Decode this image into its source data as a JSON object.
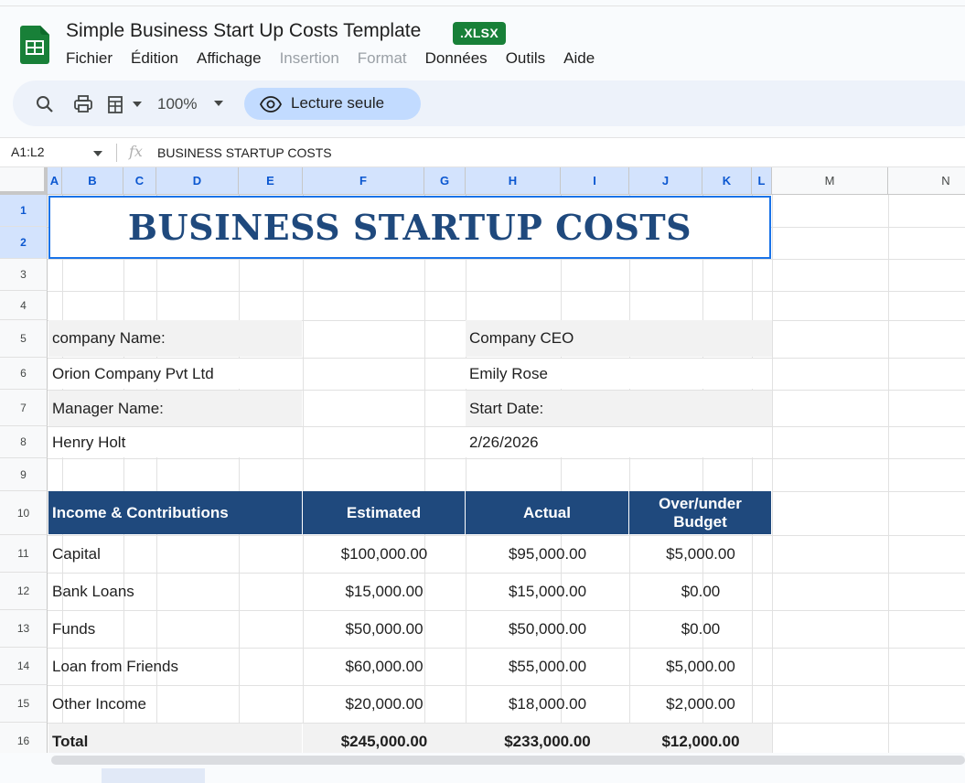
{
  "app": {
    "doc_title": "Simple Business Start Up Costs Template",
    "file_badge": ".XLSX",
    "colors": {
      "brand_green": "#188038",
      "accent_blue": "#1a73e8",
      "header_navy": "#1f497d",
      "readonly_pill": "#c2dbff"
    }
  },
  "menu": [
    {
      "label": "Fichier",
      "enabled": true
    },
    {
      "label": "Édition",
      "enabled": true
    },
    {
      "label": "Affichage",
      "enabled": true
    },
    {
      "label": "Insertion",
      "enabled": false
    },
    {
      "label": "Format",
      "enabled": false
    },
    {
      "label": "Données",
      "enabled": true
    },
    {
      "label": "Outils",
      "enabled": true
    },
    {
      "label": "Aide",
      "enabled": true
    }
  ],
  "toolbar": {
    "icons": [
      "search-icon",
      "print-icon",
      "paint-format-icon"
    ],
    "zoom": "100%",
    "readonly_label": "Lecture seule"
  },
  "formula_bar": {
    "name_box": "A1:L2",
    "fx": "fx",
    "formula": "BUSINESS STARTUP COSTS"
  },
  "columns": [
    "A",
    "B",
    "C",
    "D",
    "E",
    "F",
    "G",
    "H",
    "I",
    "J",
    "K",
    "L",
    "M",
    "N"
  ],
  "rows": [
    "1",
    "2",
    "3",
    "4",
    "5",
    "6",
    "7",
    "8",
    "9",
    "10",
    "11",
    "12",
    "13",
    "14",
    "15",
    "16"
  ],
  "sheet": {
    "title": "BUSINESS STARTUP COSTS",
    "info": {
      "company_label": "company Name:",
      "company_value": "Orion Company Pvt Ltd",
      "ceo_label": "Company CEO",
      "ceo_value": "Emily Rose",
      "manager_label": "Manager Name:",
      "manager_value": "Henry Holt",
      "start_label": "Start Date:",
      "start_value": "2/26/2026"
    },
    "table": {
      "headers": [
        "Income & Contributions",
        "Estimated",
        "Actual",
        "Over/under Budget"
      ],
      "rows": [
        [
          "Capital",
          "$100,000.00",
          "$95,000.00",
          "$5,000.00"
        ],
        [
          "Bank Loans",
          "$15,000.00",
          "$15,000.00",
          "$0.00"
        ],
        [
          "Funds",
          "$50,000.00",
          "$50,000.00",
          "$0.00"
        ],
        [
          "Loan from Friends",
          "$60,000.00",
          "$55,000.00",
          "$5,000.00"
        ],
        [
          "Other Income",
          "$20,000.00",
          "$18,000.00",
          "$2,000.00"
        ]
      ],
      "total": [
        "Total",
        "$245,000.00",
        "$233,000.00",
        "$12,000.00"
      ]
    }
  }
}
